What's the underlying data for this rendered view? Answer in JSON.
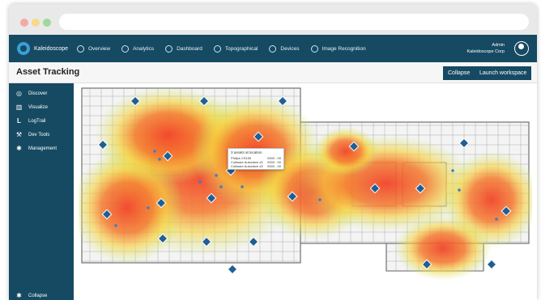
{
  "header": {
    "brand": "Kaleidoscope",
    "nav": [
      {
        "label": "Overview",
        "icon": "compass-icon"
      },
      {
        "label": "Analytics",
        "icon": "magnifier-icon"
      },
      {
        "label": "Dashboard",
        "icon": "cloud-icon"
      },
      {
        "label": "Topographical",
        "icon": "globe-icon"
      },
      {
        "label": "Devices",
        "icon": "gear-icon"
      },
      {
        "label": "Image Recognition",
        "icon": "eye-icon"
      }
    ],
    "user": {
      "name": "Admin",
      "org": "Kaleidoscope Corp"
    }
  },
  "page": {
    "title": "Asset Tracking",
    "collapse_label": "Collapse",
    "launch_label": "Launch workspace"
  },
  "sidebar": {
    "items": [
      {
        "label": "Discover",
        "icon": "compass-icon"
      },
      {
        "label": "Visualize",
        "icon": "bar-chart-icon"
      },
      {
        "label": "LogTrail",
        "icon": "log-icon"
      },
      {
        "label": "Dev Tools",
        "icon": "wrench-icon"
      },
      {
        "label": "Management",
        "icon": "gear-icon"
      }
    ],
    "collapse_label": "Collapse"
  },
  "tooltip": {
    "title": "3 assets at location",
    "rows": [
      {
        "name": "Philips CS150",
        "value": "0000 - 00"
      },
      {
        "name": "Coltware Autoclave #1",
        "value": "0000 - 00"
      },
      {
        "name": "Coltware Autoclave #2",
        "value": "0000 - 00"
      }
    ]
  },
  "colors": {
    "primary": "#164a63",
    "accent": "#3aa0d6",
    "heat_hot": "#f2442a",
    "heat_mid": "#f7d23c",
    "heat_cool": "#c8e86a"
  }
}
